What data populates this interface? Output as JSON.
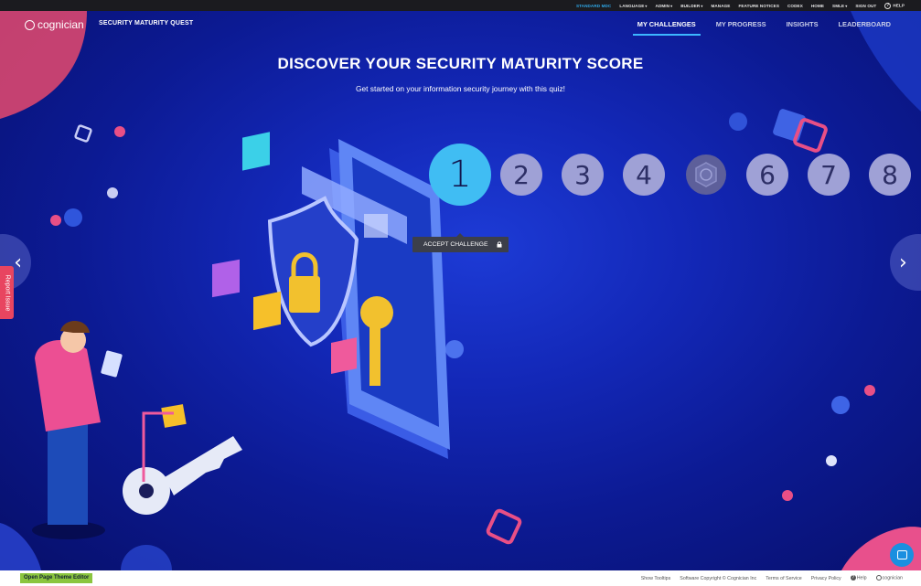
{
  "topbar": {
    "items": [
      {
        "label": "STANDARD MDC",
        "accent": true,
        "caret": false
      },
      {
        "label": "LANGUAGE",
        "accent": false,
        "caret": true
      },
      {
        "label": "ADMIN",
        "accent": false,
        "caret": true
      },
      {
        "label": "BUILDER",
        "accent": false,
        "caret": true
      },
      {
        "label": "MANAGE",
        "accent": false,
        "caret": false
      },
      {
        "label": "FEATURE NOTICES",
        "accent": false,
        "caret": false
      },
      {
        "label": "CODEX",
        "accent": false,
        "caret": false
      },
      {
        "label": "HOME",
        "accent": false,
        "caret": false
      },
      {
        "label": "SMLE",
        "accent": false,
        "caret": true
      },
      {
        "label": "SIGN OUT",
        "accent": false,
        "caret": false
      }
    ],
    "help_label": "HELP"
  },
  "header": {
    "logo_text": "cognician",
    "app_title": "SECURITY MATURITY QUEST",
    "nav": [
      {
        "label": "MY CHALLENGES",
        "active": true
      },
      {
        "label": "MY PROGRESS",
        "active": false
      },
      {
        "label": "INSIGHTS",
        "active": false
      },
      {
        "label": "LEADERBOARD",
        "active": false
      }
    ]
  },
  "hero": {
    "title": "DISCOVER YOUR SECURITY MATURITY SCORE",
    "subtitle": "Get started on your information security journey with this quiz!"
  },
  "steps": [
    {
      "label": "1",
      "state": "active"
    },
    {
      "label": "2",
      "state": "pending"
    },
    {
      "label": "3",
      "state": "pending"
    },
    {
      "label": "4",
      "state": "pending"
    },
    {
      "label": "",
      "state": "locked",
      "icon": "badge-icon"
    },
    {
      "label": "6",
      "state": "pending"
    },
    {
      "label": "7",
      "state": "pending"
    },
    {
      "label": "8",
      "state": "pending"
    }
  ],
  "accept_button": {
    "label": "ACCEPT CHALLENGE",
    "icon": "lock-icon"
  },
  "report_tab": {
    "label": "Report Issue"
  },
  "footer": {
    "theme_editor_label": "Open Page Theme Editor",
    "links": [
      {
        "label": "Show Tooltips"
      },
      {
        "label": "Software Copyright © Cognician Inc"
      },
      {
        "label": "Terms of Service"
      },
      {
        "label": "Privacy Policy"
      }
    ],
    "help_label": "Help",
    "brand_label": "cognician"
  },
  "colors": {
    "accent": "#40bdf3",
    "topbar_accent": "#2fa8e8",
    "report": "#e84560",
    "theme_button": "#8bc53f"
  }
}
